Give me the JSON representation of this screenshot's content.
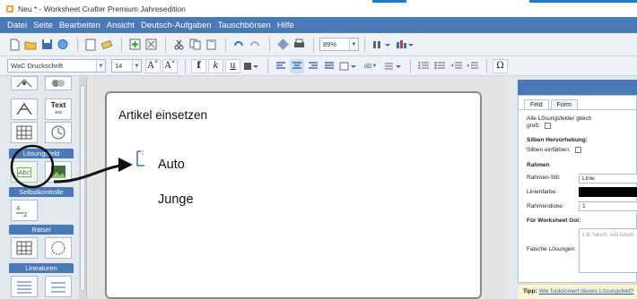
{
  "window": {
    "title": "Neu * - Worksheet Crafter Premium Jahresedition"
  },
  "menu": [
    "Datei",
    "Seite",
    "Bearbeiten",
    "Ansicht",
    "Deutsch-Aufgaben",
    "Tauschbörsen",
    "Hilfe"
  ],
  "toolbar": {
    "zoom_value": "89%",
    "font_family": "WaC Druckschrift",
    "font_size": "14",
    "grow_font_glyph": "A˄",
    "shrink_font_glyph": "A˅",
    "bold_glyph": "f",
    "italic_glyph": "k",
    "underline_glyph": "u",
    "syllable_glyph": "ab",
    "special_char_glyph": "Ω"
  },
  "sidebar": {
    "text_tool_label": "Text",
    "text_tool_sub": "≡≡",
    "groups": [
      {
        "label": "Lösungsfeld"
      },
      {
        "label": "Selbstkontrolle"
      },
      {
        "label": "Rätsel"
      },
      {
        "label": "Lineaturen"
      }
    ],
    "solution_tool_label": "Abc"
  },
  "worksheet": {
    "heading": "Artikel einsetzen",
    "words": [
      "Auto",
      "Junge"
    ]
  },
  "properties": {
    "tabs": [
      "Feld",
      "Form"
    ],
    "all_fields_same_size": "Alle Lösungsfelder gleich groß:",
    "syllable_section": "Silben Hervorhebung:",
    "syllable_show": "Silben einfärben:",
    "frame_section": "Rahmen",
    "frame_style_label": "Rahmen-Stil:",
    "frame_style_value": "Linie",
    "line_color_label": "Linienfarbe:",
    "line_color_value": "#000000",
    "frame_thickness_label": "Rahmendicke:",
    "frame_thickness_value": "1",
    "worksheet_gol_section": "Für Worksheet Gol:",
    "wrong_solutions_label": "Falsche Lösungen:",
    "wrong_solutions_placeholder": "z.B. falsch, voll falsch"
  },
  "tip": {
    "label": "Tipp:",
    "link": "Wie funktioniert dieses Lösungsfeld?"
  },
  "colors": {
    "menu_blue": "#4a79b7",
    "accent_blue": "#1e7bd6"
  }
}
